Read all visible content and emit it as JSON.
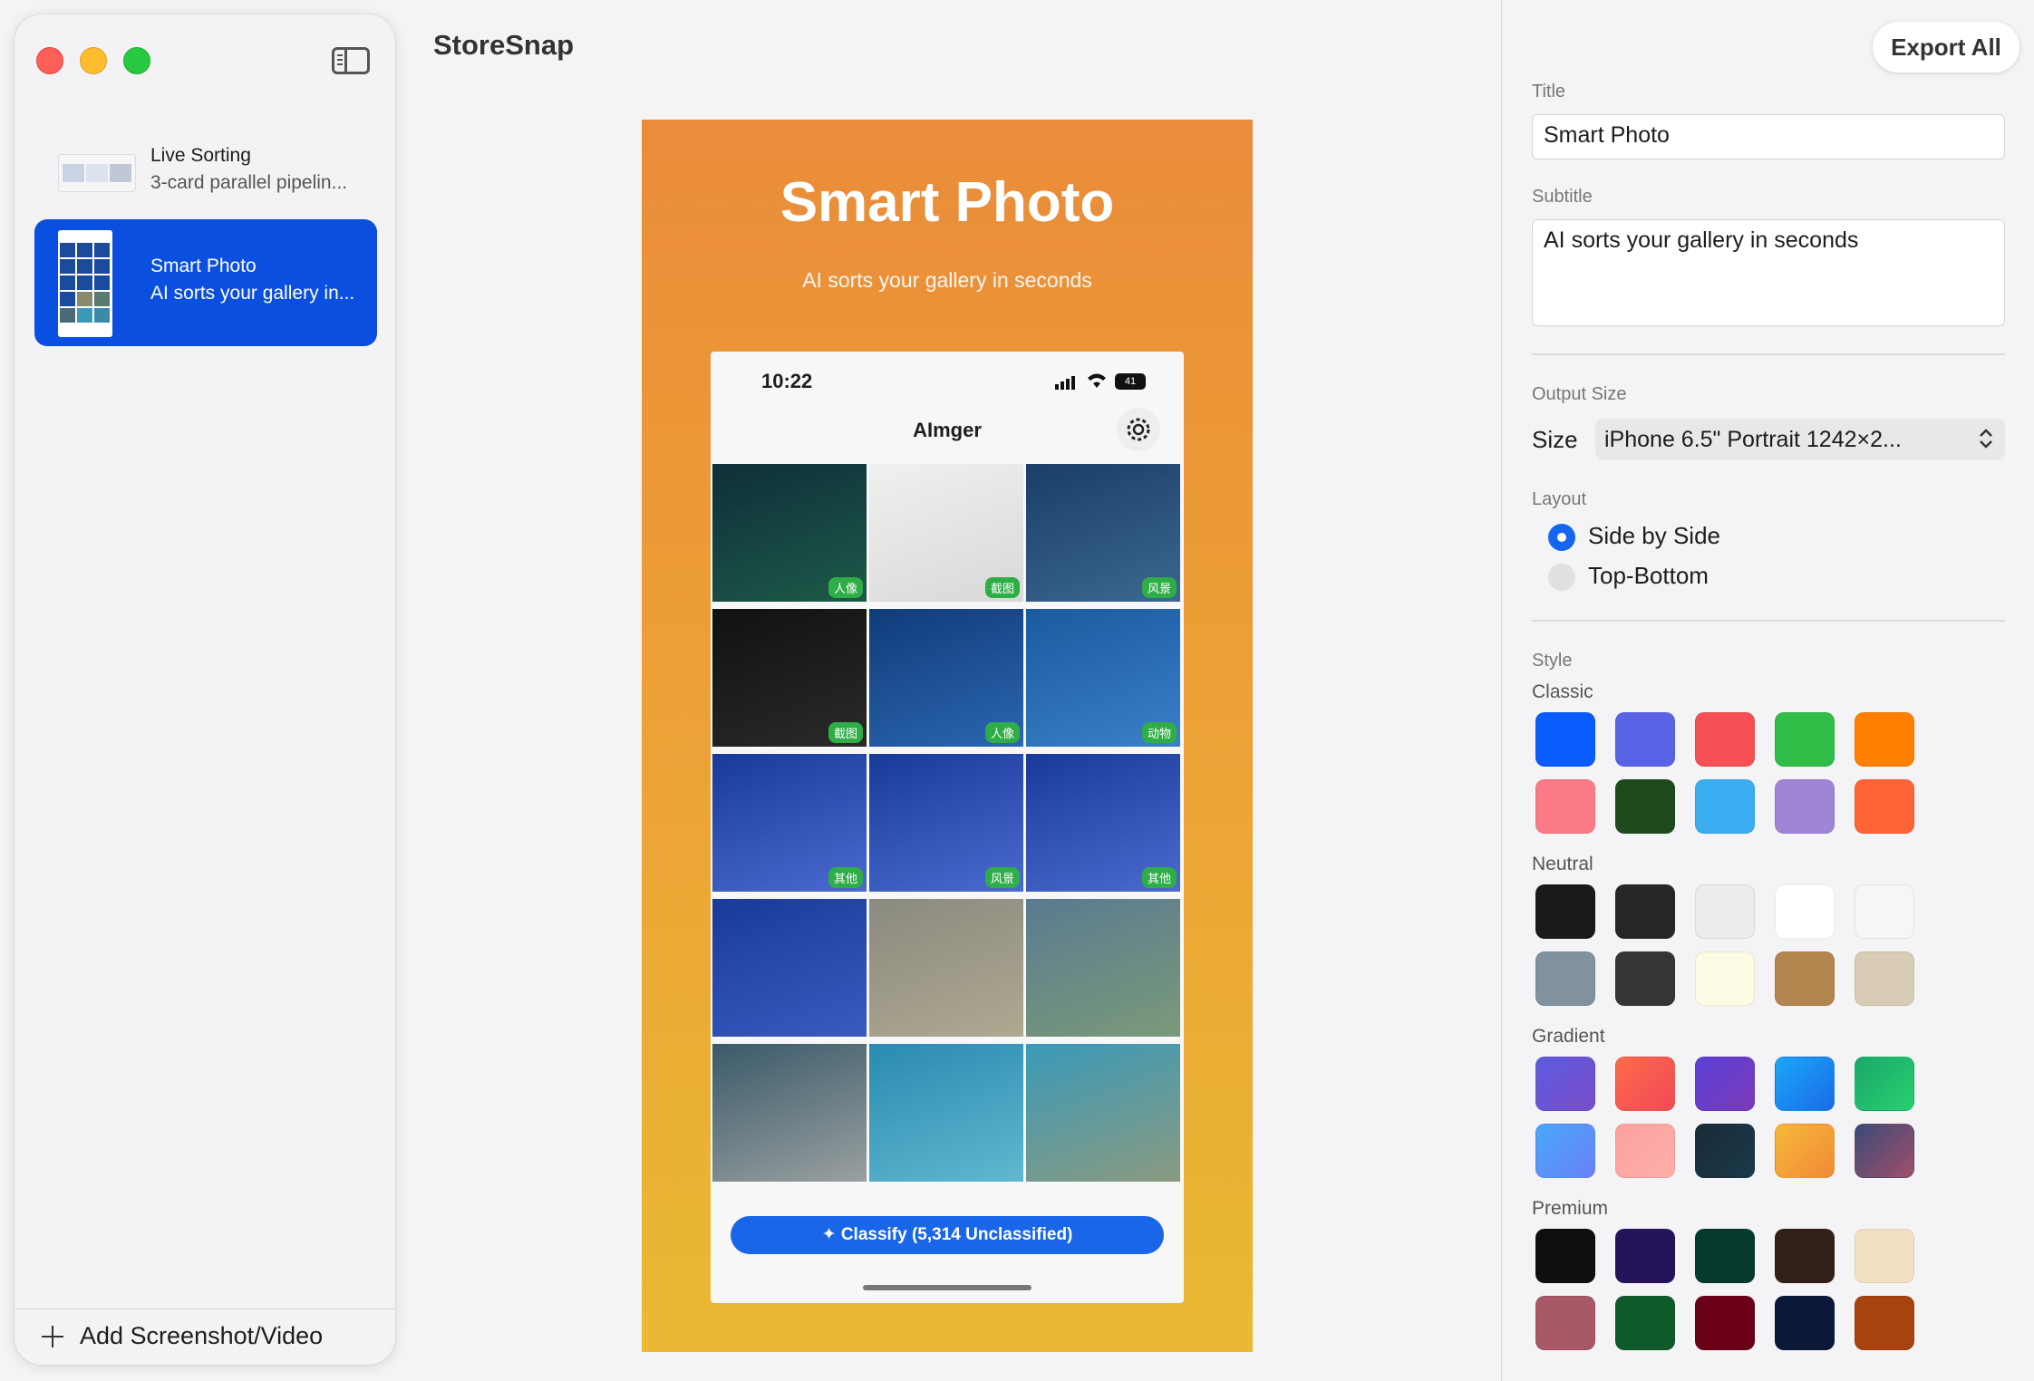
{
  "sidebar": {
    "items": [
      {
        "title": "Live Sorting",
        "subtitle": "3-card parallel pipelin..."
      },
      {
        "title": "Smart Photo",
        "subtitle": "AI sorts your gallery in..."
      }
    ],
    "add_label": "Add Screenshot/Video"
  },
  "header": {
    "app_title": "StoreSnap"
  },
  "canvas": {
    "title": "Smart Photo",
    "subtitle": "AI sorts your gallery in seconds",
    "phone": {
      "time": "10:22",
      "battery": "41",
      "nav_title": "AImger",
      "tiles": [
        {
          "tag": "人像",
          "c1": "#0e2f3a",
          "c2": "#1e5a48"
        },
        {
          "tag": "截图",
          "c1": "#f0f0f0",
          "c2": "#d8d8d8"
        },
        {
          "tag": "风景",
          "c1": "#1b3d6a",
          "c2": "#3a6890"
        },
        {
          "tag": "截图",
          "c1": "#111111",
          "c2": "#2a2a2a"
        },
        {
          "tag": "人像",
          "c1": "#103c7a",
          "c2": "#2b66b0"
        },
        {
          "tag": "动物",
          "c1": "#1a5aa0",
          "c2": "#3a80c8"
        },
        {
          "tag": "其他",
          "c1": "#1a3a9a",
          "c2": "#4a6ad0"
        },
        {
          "tag": "风景",
          "c1": "#1a3a9a",
          "c2": "#4a6ad0"
        },
        {
          "tag": "其他",
          "c1": "#1a3a9a",
          "c2": "#4a6ad0"
        },
        {
          "tag": "",
          "c1": "#1a3a9a",
          "c2": "#3a5ac0"
        },
        {
          "tag": "",
          "c1": "#8a8a80",
          "c2": "#b0a890"
        },
        {
          "tag": "",
          "c1": "#5a7a90",
          "c2": "#7a9a7a"
        },
        {
          "tag": "",
          "c1": "#3a5a6a",
          "c2": "#9aa0a0"
        },
        {
          "tag": "",
          "c1": "#2a8ab0",
          "c2": "#60b8d0"
        },
        {
          "tag": "",
          "c1": "#3a9ab8",
          "c2": "#8a9a80"
        }
      ],
      "classify_label": "Classify (5,314 Unclassified)"
    }
  },
  "inspector": {
    "export_label": "Export All",
    "title_label": "Title",
    "title_value": "Smart Photo",
    "subtitle_label": "Subtitle",
    "subtitle_value": "AI sorts your gallery in seconds",
    "output_size_label": "Output Size",
    "size_label": "Size",
    "size_value": "iPhone 6.5\" Portrait 1242×2...",
    "layout_label": "Layout",
    "layout_options": [
      {
        "label": "Side by Side",
        "selected": true
      },
      {
        "label": "Top-Bottom",
        "selected": false
      }
    ],
    "style_label": "Style",
    "groups": [
      {
        "name": "Classic",
        "swatches": [
          "#0a5cff",
          "#5a63e6",
          "#f64f55",
          "#30be48",
          "#ff8000",
          "#fb7a88",
          "#1f4a1e",
          "#3aaef0",
          "#a084d6",
          "#ff6436"
        ]
      },
      {
        "name": "Neutral",
        "swatches": [
          "#1a1a1c",
          "#262628",
          "#ececec",
          "#ffffff",
          "#f6f6f6",
          "#7f929e",
          "#353535",
          "#fdfbe3",
          "#b38650",
          "#d8ccb4"
        ]
      },
      {
        "name": "Gradient",
        "swatches": [
          "linear-gradient(135deg,#5a5ce0,#7b4cc8)",
          "linear-gradient(135deg,#fe6a48,#f04a58)",
          "linear-gradient(135deg,#5a40d8,#7c3ab8)",
          "linear-gradient(135deg,#1aa8f8,#1a6ae8)",
          "linear-gradient(135deg,#1aa86a,#2ad070)",
          "linear-gradient(135deg,#48a8f8,#6a80f8)",
          "linear-gradient(135deg,#fca0a0,#fcb0a8)",
          "linear-gradient(135deg,#1a2a38,#1a3a4a)",
          "linear-gradient(135deg,#f6b838,#f08a38)",
          "linear-gradient(135deg,#3a4a78,#a0506a)"
        ]
      },
      {
        "name": "Premium",
        "swatches": [
          "#0f0f10",
          "#26145a",
          "#053a2c",
          "#302018",
          "#f2e0c2",
          "#a85866",
          "#0e5a2a",
          "#6a0018",
          "#0c183a",
          "#a8420f"
        ]
      }
    ]
  }
}
